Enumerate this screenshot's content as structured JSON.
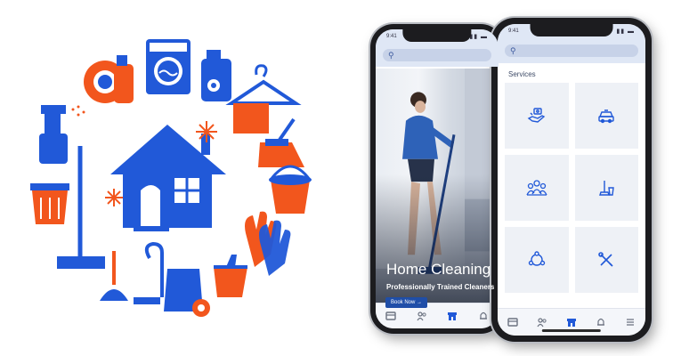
{
  "back_phone": {
    "status_time": "9:41",
    "hero_title": "Home Cleaning",
    "hero_subtitle": "Professionally Trained Cleaners",
    "book_button": "Book Now  →"
  },
  "front_phone": {
    "status_time": "9:41",
    "section_title": "Services",
    "services": [
      {
        "icon": "hand-money-icon"
      },
      {
        "icon": "car-icon"
      },
      {
        "icon": "group-people-icon"
      },
      {
        "icon": "cleaning-tools-icon"
      },
      {
        "icon": "network-people-icon"
      },
      {
        "icon": "tools-icon"
      }
    ]
  },
  "tabs": [
    "home-tab-icon",
    "people-tab-icon",
    "store-tab-icon",
    "bell-tab-icon",
    "menu-tab-icon"
  ],
  "colors": {
    "brand_blue": "#1f4ea8",
    "illustration_blue": "#2159d8",
    "illustration_orange": "#f2561d",
    "tile_bg": "#eef1f6"
  }
}
